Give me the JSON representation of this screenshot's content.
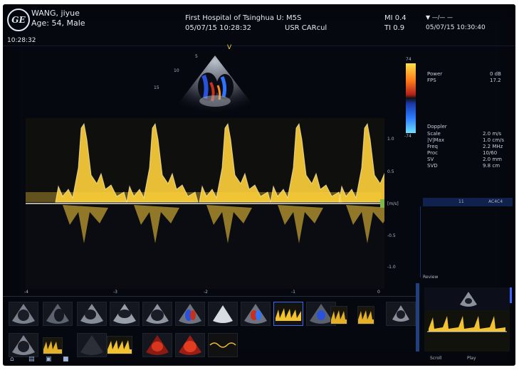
{
  "header": {
    "patient_name": "WANG, jiyue",
    "patient_info": "Age: 54, Male",
    "hospital": "First Hospital of Tsinghua U: M5S",
    "exam_datetime": "05/07/15 10:28:32",
    "preset": "USR CARcul",
    "mi": "MI 0.4",
    "ti": "TI 0.9",
    "system_datetime": "05/07/15 10:30:40",
    "status_symbol": "—/— —",
    "time_clock": "10:28:32"
  },
  "image_markers": {
    "probe_marker": "V",
    "depth_5": "5",
    "depth_10": "10",
    "depth_15": "15"
  },
  "right_panel": {
    "colorbar_top": "74",
    "colorbar_bottom": "-74",
    "power_label": "Power",
    "power_value": "0 dB",
    "fps_label": "FPS",
    "fps_value": "17.2",
    "doppler_title": "Doppler",
    "params": [
      {
        "label": "Scale",
        "value": "2.0 m/s"
      },
      {
        "label": "|V|Max",
        "value": "1.0 cm/s"
      },
      {
        "label": "Freq",
        "value": "2.2 MHz"
      },
      {
        "label": "Proc",
        "value": "10/60"
      },
      {
        "label": "SV",
        "value": "2.0 mm"
      },
      {
        "label": "SVD",
        "value": "9.8 cm"
      }
    ],
    "bar_left": "11",
    "bar_right": "AC4C4",
    "review_label": "Review",
    "btn_left": "Scroll",
    "btn_right": "Play"
  },
  "doppler_scale": {
    "tick_1": "1.0",
    "tick_05": "0.5",
    "baseline_unit": "[m/s]",
    "tick_m05": "-0.5",
    "tick_m1": "-1.0"
  },
  "time_axis": [
    "-4",
    "-3",
    "-2",
    "-1",
    "0"
  ],
  "thumbnails": {
    "row1": [
      "a4c",
      "a2c",
      "a3c",
      "plax",
      "a4c",
      "color",
      "cone",
      "color",
      "doppler-selected",
      "color2",
      "doppler",
      "doppler",
      "a4c-small"
    ],
    "row2": [
      "a4c-small",
      "doppler-small",
      "dark",
      "doppler-small",
      "red-color",
      "red-color",
      "m-trace"
    ]
  },
  "toolbar_icons": [
    "home-icon",
    "folder-icon",
    "print-icon",
    "save-icon"
  ],
  "colors": {
    "spectrum": "#ffd23a",
    "background": "#06080f",
    "baseline": "#7fb84a",
    "selection": "#3d66ff"
  }
}
